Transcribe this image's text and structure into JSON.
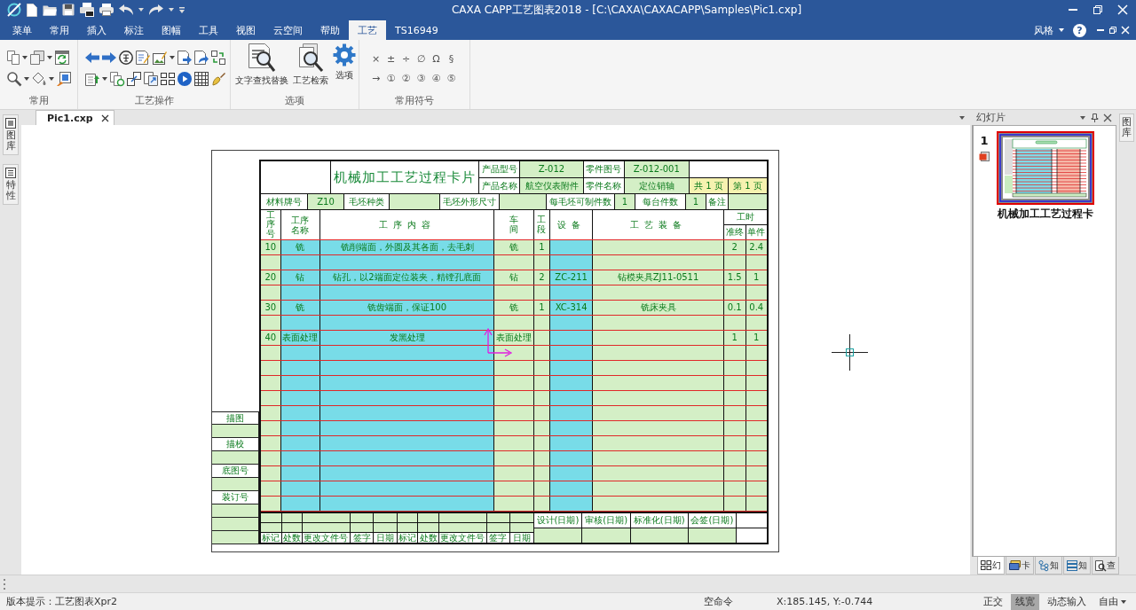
{
  "title_bar": {
    "title": "CAXA CAPP工艺图表2018 - [C:\\CAXA\\CAXACAPP\\Samples\\Pic1.cxp]"
  },
  "ribbon": {
    "tabs": [
      {
        "label": "菜单",
        "selected": false
      },
      {
        "label": "常用",
        "selected": false
      },
      {
        "label": "插入",
        "selected": false
      },
      {
        "label": "标注",
        "selected": false
      },
      {
        "label": "图幅",
        "selected": false
      },
      {
        "label": "工具",
        "selected": false
      },
      {
        "label": "视图",
        "selected": false
      },
      {
        "label": "云空间",
        "selected": false
      },
      {
        "label": "帮助",
        "selected": false
      },
      {
        "label": "工艺",
        "selected": true
      },
      {
        "label": "TS16949",
        "selected": false
      }
    ],
    "style_menu": "风格",
    "help": "?",
    "groups": [
      {
        "kind": "common",
        "label": "常用"
      },
      {
        "kind": "process",
        "label": "工艺操作"
      },
      {
        "kind": "options",
        "label": "选项",
        "buttons": [
          {
            "kind": "find-replace",
            "label": "文字查找替换"
          },
          {
            "kind": "search",
            "label": "工艺检索"
          },
          {
            "kind": "settings",
            "label": "选项"
          }
        ]
      },
      {
        "kind": "symbols",
        "label": "常用符号",
        "symbols": [
          "×",
          "±",
          "÷",
          "∅",
          "Ω",
          "§",
          "→",
          "①",
          "②",
          "③",
          "④",
          "⑤"
        ]
      }
    ]
  },
  "document_tabs": [
    {
      "label": "Pic1.cxp",
      "selected": true
    }
  ],
  "left_dock": [
    {
      "kind": "library",
      "label": "图库"
    },
    {
      "kind": "properties",
      "label": "特性"
    }
  ],
  "card": {
    "title": "机械加工工艺过程卡片",
    "fields": [
      {
        "label": "产品型号",
        "value": "Z-012"
      },
      {
        "label": "零件图号",
        "value": "Z-012-001"
      },
      {
        "label": "产品名称",
        "value": "航空仪表附件"
      },
      {
        "label": "零件名称",
        "value": "定位销轴"
      }
    ],
    "pages": [
      "共 1 页",
      "第 1 页"
    ],
    "material": [
      {
        "label": "材料牌号",
        "value": "Z10"
      },
      {
        "label": "毛坯种类"
      },
      {
        "label": "毛坯外形尺寸"
      },
      {
        "label": "每毛坯可制件数",
        "value": "1"
      },
      {
        "label": "每台件数",
        "value": "1"
      },
      {
        "label": "备注"
      }
    ],
    "columns": [
      {
        "label": "工序号",
        "highlighted": false
      },
      {
        "label": "工序名称",
        "highlighted": true
      },
      {
        "label": "工序内容",
        "highlighted": true
      },
      {
        "label": "车间",
        "highlighted": false
      },
      {
        "label": "工段",
        "highlighted": false
      },
      {
        "label": "设备",
        "highlighted": true
      },
      {
        "label": "工艺装备",
        "highlighted": false
      },
      {
        "label": "工时",
        "highlighted": false,
        "sub_columns": [
          "准终",
          "单件"
        ]
      }
    ],
    "steps": [
      {
        "no": "10",
        "name": "铣",
        "content": "铣削端面，外圆及其各面，去毛刺",
        "workshop": "铣",
        "section": "1",
        "setup": "2",
        "unit": "2.4"
      },
      {
        "no": "20",
        "name": "钻",
        "content": "钻孔，以2端面定位装夹，精镗孔底面",
        "workshop": "钻",
        "section": "2",
        "equipment": "ZC-211",
        "tooling": "钻模夹具ZJ11-0511",
        "setup": "1.5",
        "unit": "1"
      },
      {
        "no": "30",
        "name": "铣",
        "content": "铣齿端面，保证100",
        "workshop": "铣",
        "section": "1",
        "equipment": "XC-314",
        "tooling": "铣床夹具",
        "setup": "0.1",
        "unit": "0.4"
      },
      {
        "no": "40",
        "name": "表面处理",
        "content": "发黑处理",
        "workshop": "表面处理",
        "setup": "1",
        "unit": "1"
      }
    ],
    "side_labels": [
      "描图",
      "描校",
      "底图号",
      "装订号"
    ],
    "change_log": [
      "标记",
      "处数",
      "更改文件号",
      "签字",
      "日期",
      "标记",
      "处数",
      "更改文件号",
      "签字",
      "日期"
    ],
    "signoffs": [
      "设计(日期)",
      "审核(日期)",
      "标准化(日期)",
      "会签(日期)"
    ]
  },
  "slides_panel": {
    "title": "幻灯片",
    "slides": [
      {
        "number": "1",
        "caption": "机械加工工艺过程卡",
        "selected": true
      }
    ],
    "tabs": [
      {
        "kind": "slides",
        "label": "幻",
        "selected": true
      },
      {
        "kind": "card",
        "label": "卡",
        "selected": false
      },
      {
        "kind": "tree",
        "label": "知",
        "selected": false
      },
      {
        "kind": "list",
        "label": "知",
        "selected": false
      },
      {
        "kind": "search",
        "label": "查",
        "selected": false
      }
    ]
  },
  "right_dock": [
    "图库"
  ],
  "status_bar": {
    "hint": "版本提示：工艺图表Xpr2",
    "command": "空命令",
    "coordinates": "X:185.145, Y:-0.744",
    "toggles": [
      {
        "label": "正交",
        "on": false
      },
      {
        "label": "线宽",
        "on": true
      },
      {
        "label": "动态输入",
        "on": false
      },
      {
        "label": "自由",
        "on": false,
        "menu": true
      }
    ]
  }
}
